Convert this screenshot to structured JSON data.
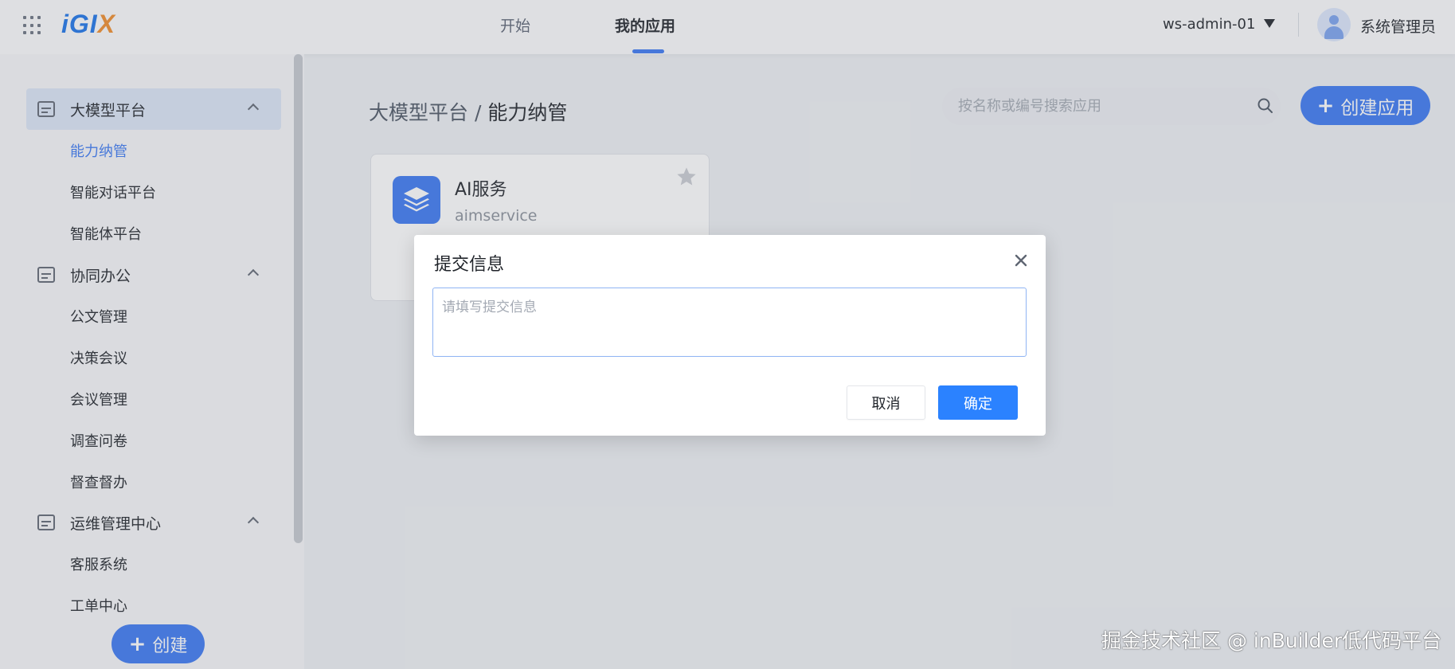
{
  "topbar": {
    "logo": "iGIX",
    "logo_i": "iGI",
    "logo_x": "X",
    "tabs": [
      {
        "label": "开始",
        "active": false
      },
      {
        "label": "我的应用",
        "active": true
      }
    ],
    "workspace": "ws-admin-01",
    "user": "系统管理员"
  },
  "sidebar": {
    "groups": [
      {
        "label": "大模型平台",
        "icon": "chart-icon",
        "expanded": true,
        "active": true,
        "items": [
          {
            "label": "能力纳管",
            "active": true
          },
          {
            "label": "智能对话平台"
          },
          {
            "label": "智能体平台"
          }
        ]
      },
      {
        "label": "协同办公",
        "icon": "list-icon",
        "expanded": true,
        "items": [
          {
            "label": "公文管理"
          },
          {
            "label": "决策会议"
          },
          {
            "label": "会议管理"
          },
          {
            "label": "调查问卷"
          },
          {
            "label": "督查督办"
          }
        ]
      },
      {
        "label": "运维管理中心",
        "icon": "sliders-icon",
        "expanded": true,
        "items": [
          {
            "label": "客服系统"
          },
          {
            "label": "工单中心"
          }
        ]
      }
    ],
    "create_label": "创建"
  },
  "main": {
    "breadcrumb_parent": "大模型平台",
    "breadcrumb_sep": " / ",
    "breadcrumb_current": "能力纳管",
    "search_placeholder": "按名称或编号搜索应用",
    "create_button": "创建应用",
    "apps": [
      {
        "name": "AI服务",
        "code": "aimservice",
        "icon": "layers-icon",
        "starred": false
      }
    ]
  },
  "modal": {
    "title": "提交信息",
    "textarea_placeholder": "请填写提交信息",
    "textarea_value": "",
    "cancel": "取消",
    "confirm": "确定"
  },
  "watermark": "掘金技术社区 @ inBuilder低代码平台",
  "colors": {
    "accent": "#3a78f2",
    "confirm": "#2b82ff",
    "logo_blue": "#1a73e8",
    "logo_orange": "#f08c2a"
  }
}
